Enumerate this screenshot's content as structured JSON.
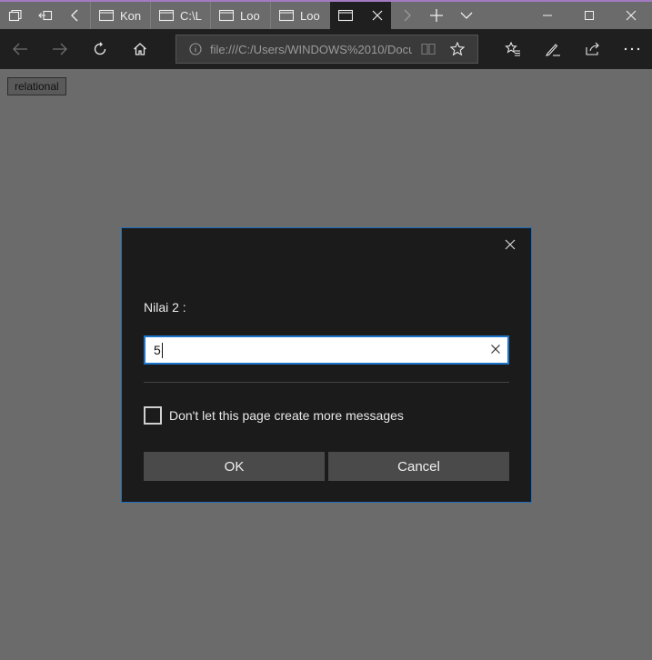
{
  "browser": {
    "tabs": [
      {
        "label": "Kon"
      },
      {
        "label": "C:\\L"
      },
      {
        "label": "Loo"
      },
      {
        "label": "Loo"
      },
      {
        "label": "",
        "active": true
      }
    ],
    "address": {
      "url": "file:///C:/Users/WINDOWS%2010/Docu"
    },
    "colors": {
      "accent": "#1d75c9",
      "chrome": "#1f1f1f",
      "page_bg": "#6b6b6b",
      "title_border": "#a27ac2"
    }
  },
  "page": {
    "button_label": "relational"
  },
  "dialog": {
    "label": "Nilai 2 :",
    "input_value": "5",
    "checkbox_label": "Don't let this page create more messages",
    "checkbox_checked": false,
    "ok_label": "OK",
    "cancel_label": "Cancel"
  }
}
